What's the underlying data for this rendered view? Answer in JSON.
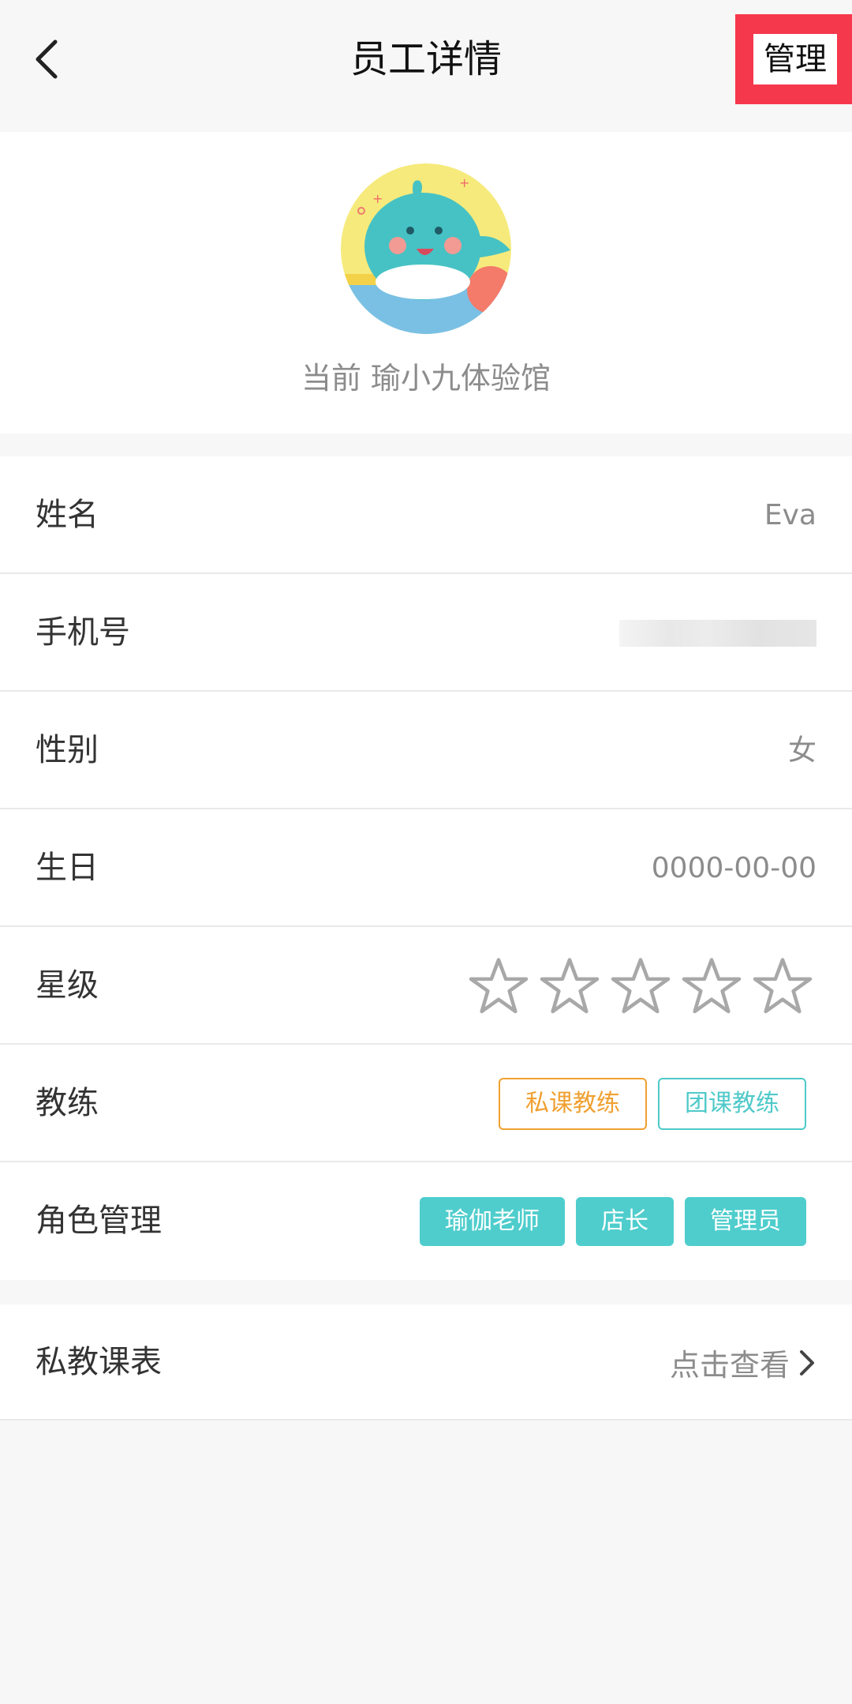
{
  "header": {
    "title": "员工详情",
    "back_icon": "chevron-left-icon",
    "manage_label": "管理"
  },
  "profile": {
    "avatar": "whale-avatar",
    "caption": "当前 瑜小九体验馆"
  },
  "details": {
    "name": {
      "label": "姓名",
      "value": "Eva"
    },
    "phone": {
      "label": "手机号"
    },
    "gender": {
      "label": "性别",
      "value": "女"
    },
    "birthday": {
      "label": "生日",
      "value": "0000-00-00"
    },
    "rating": {
      "label": "星级",
      "stars_filled": 0,
      "stars_total": 5
    },
    "coach": {
      "label": "教练",
      "tags": [
        "私课教练",
        "团课教练"
      ]
    },
    "roles": {
      "label": "角色管理",
      "tags": [
        "瑜伽老师",
        "店长",
        "管理员"
      ]
    }
  },
  "schedule": {
    "label": "私教课表",
    "link_label": "点击查看",
    "link_icon": "chevron-right-icon"
  },
  "colors": {
    "highlight": "#f6384c",
    "accent_teal": "#4fcdcd",
    "accent_orange": "#f0a030"
  }
}
